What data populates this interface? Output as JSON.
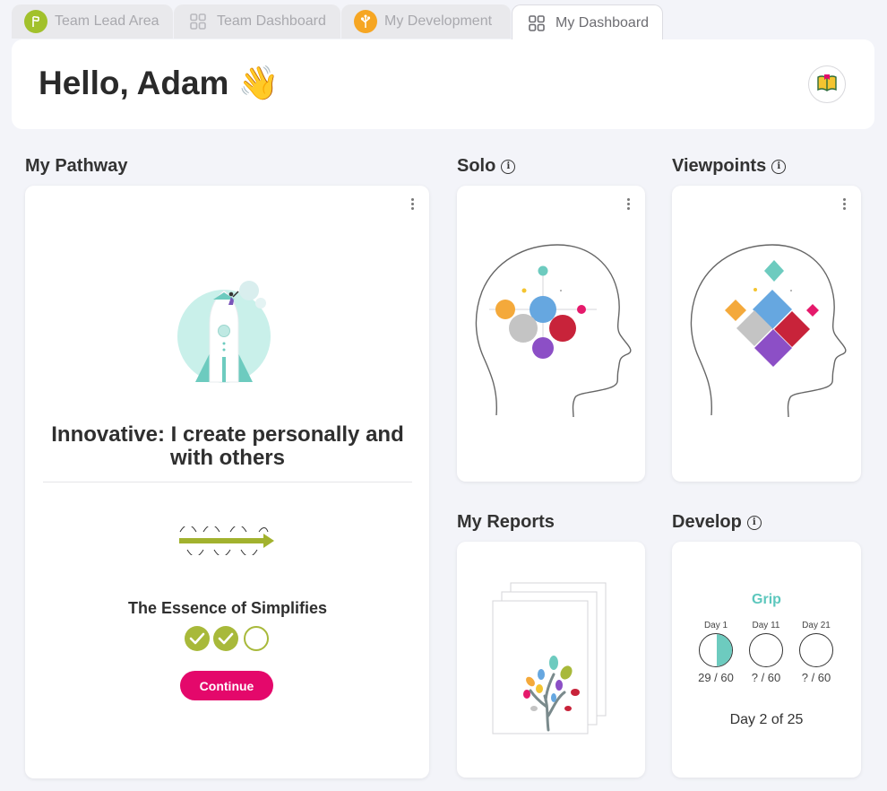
{
  "tabs": [
    {
      "label": "Team Lead Area",
      "icon": "team-lead-icon",
      "color": "#a2c12c"
    },
    {
      "label": "Team Dashboard",
      "icon": "grid-icon"
    },
    {
      "label": "My Development",
      "icon": "tree-icon",
      "color": "#f6a623"
    },
    {
      "label": "My Dashboard",
      "icon": "grid-icon",
      "active": true
    }
  ],
  "header": {
    "greeting": "Hello, Adam 👋"
  },
  "sections": {
    "pathway": "My Pathway",
    "solo": "Solo",
    "viewpoints": "Viewpoints",
    "reports": "My Reports",
    "develop": "Develop"
  },
  "pathway": {
    "title": "Innovative: I create personally and with others",
    "essence": "The Essence of Simplifies",
    "progress": {
      "completed": 2,
      "total": 3
    },
    "continue_label": "Continue"
  },
  "develop": {
    "title": "Grip",
    "days": [
      {
        "label": "Day 1",
        "score": "29 / 60",
        "progress": 0.48
      },
      {
        "label": "Day 11",
        "score": "? / 60",
        "progress": 0
      },
      {
        "label": "Day 21",
        "score": "? / 60",
        "progress": 0
      }
    ],
    "day_of": "Day 2 of 25"
  },
  "colors": {
    "accent_pink": "#e4086b",
    "teal": "#5cc7bd",
    "olive": "#a2b22e",
    "orange": "#f4a93b",
    "blue": "#66a7e0",
    "red": "#c8233a",
    "purple": "#8c4fc6",
    "gray": "#c2c2c2",
    "magenta": "#e5196b"
  }
}
